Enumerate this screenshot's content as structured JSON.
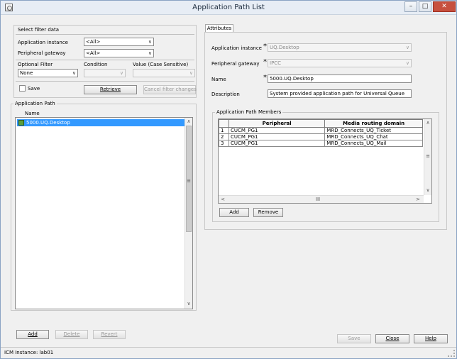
{
  "window": {
    "title": "Application Path List",
    "controls": {
      "minimize": "–",
      "maximize": "□",
      "close": "✕"
    }
  },
  "filter": {
    "heading": "Select filter data",
    "app_instance_label": "Application instance",
    "app_instance_value": "<All>",
    "peripheral_gateway_label": "Peripheral gateway",
    "peripheral_gateway_value": "<All>",
    "optional_filter_label": "Optional Filter",
    "optional_filter_value": "None",
    "condition_label": "Condition",
    "condition_value": "",
    "value_label": "Value (Case Sensitive)",
    "value_value": "",
    "save_label": "Save",
    "retrieve_label": "Retrieve",
    "cancel_label": "Cancel filter changes"
  },
  "app_path_list": {
    "heading": "Application Path",
    "column_name": "Name",
    "items": [
      "5000.UQ.Desktop"
    ],
    "selected_index": 0
  },
  "left_buttons": {
    "add": "Add",
    "delete": "Delete",
    "revert": "Revert"
  },
  "attributes": {
    "tab_label": "Attributes",
    "app_instance_label": "Application instance",
    "app_instance_value": "UQ.Desktop",
    "peripheral_gateway_label": "Peripheral gateway",
    "peripheral_gateway_value": "IPCC",
    "name_label": "Name",
    "name_value": "5000.UQ.Desktop",
    "description_label": "Description",
    "description_value": "System provided application path for Universal Queue",
    "required_marker": "*",
    "members": {
      "heading": "Application Path Members",
      "columns": [
        "",
        "Peripheral",
        "Media routing domain"
      ],
      "rows": [
        {
          "index": "1",
          "peripheral": "CUCM_PG1",
          "mrd": "MRD_Connects_UQ_Ticket"
        },
        {
          "index": "2",
          "peripheral": "CUCM_PG1",
          "mrd": "MRD_Connects_UQ_Chat"
        },
        {
          "index": "3",
          "peripheral": "CUCM_PG1",
          "mrd": "MRD_Connects_UQ_Mail"
        }
      ],
      "add_label": "Add",
      "remove_label": "Remove"
    }
  },
  "bottom_buttons": {
    "save": "Save",
    "close": "Close",
    "help": "Help"
  },
  "status": {
    "text": "ICM Instance: lab01"
  },
  "icons": {
    "dropdown": "∨",
    "scroll_up": "∧",
    "scroll_down": "∨",
    "scroll_left": "<",
    "scroll_right": ">",
    "grip_v": "≡",
    "grip_h": "III"
  }
}
